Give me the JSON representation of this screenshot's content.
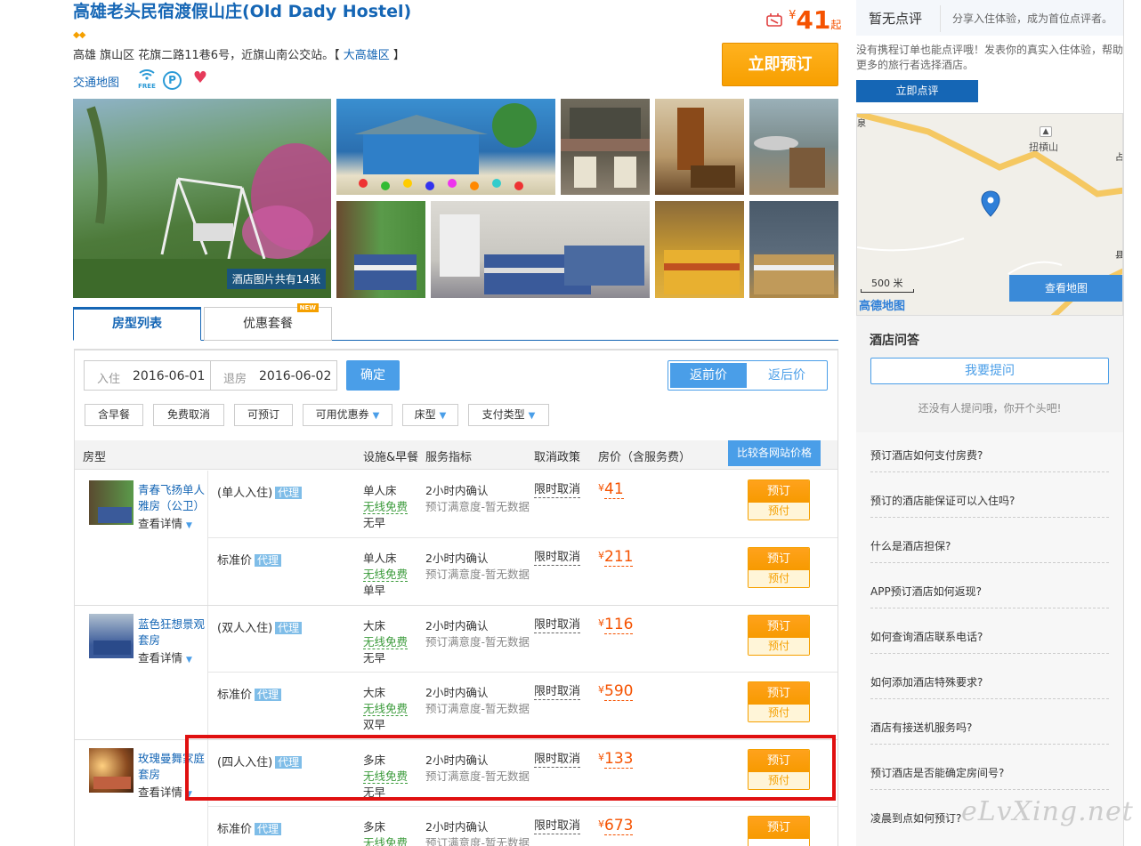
{
  "hotel": {
    "title": "高雄老头民宿渡假山庄(Old Dady Hostel)",
    "diamonds": "◆◆",
    "address_prefix": "高雄 旗山区 花旗二路11巷6号，近旗山南公交站。【",
    "area_link": "大高雄区",
    "address_suffix": "】",
    "map_link": "交通地图",
    "amenities": {
      "wifi_icon": "wifi-icon",
      "wifi_label": "FREE",
      "parking_label": "P",
      "heart": "♥"
    },
    "price_currency": "¥",
    "price_value": "41",
    "price_suffix": "起",
    "book_now": "立即预订",
    "photo_count_label": "酒店图片共有14张"
  },
  "tabs": [
    {
      "label": "房型列表",
      "active": true
    },
    {
      "label": "优惠套餐",
      "badge": "NEW"
    }
  ],
  "search": {
    "checkin_label": "入住",
    "checkin_value": "2016-06-01",
    "checkout_label": "退房",
    "checkout_value": "2016-06-02",
    "confirm": "确定",
    "toggle_before": "返前价",
    "toggle_after": "返后价"
  },
  "filters": [
    "含早餐",
    "免费取消",
    "可预订",
    "可用优惠券",
    "床型",
    "支付类型"
  ],
  "table_headers": {
    "room_type": "房型",
    "facilities": "设施&早餐",
    "service": "服务指标",
    "cancel": "取消政策",
    "price": "房价（含服务费）",
    "compare": "比较各网站价格"
  },
  "rooms": [
    {
      "name": "青春飞扬单人雅房（公卫）",
      "detail": "查看详情",
      "rates": [
        {
          "label": "(单人入住)",
          "agent": "代理",
          "bed": "单人床",
          "wifi": "无线免费",
          "breakfast": "无早",
          "svc1": "2小时内确认",
          "svc2": "预订满意度-暂无数据",
          "cancel": "限时取消",
          "price": "41",
          "book": "预订",
          "pay": "预付"
        },
        {
          "label": "标准价",
          "agent": "代理",
          "bed": "单人床",
          "wifi": "无线免费",
          "breakfast": "单早",
          "svc1": "2小时内确认",
          "svc2": "预订满意度-暂无数据",
          "cancel": "限时取消",
          "price": "211",
          "book": "预订",
          "pay": "预付"
        }
      ]
    },
    {
      "name": "蓝色狂想景观套房",
      "detail": "查看详情",
      "rates": [
        {
          "label": "(双人入住)",
          "agent": "代理",
          "bed": "大床",
          "wifi": "无线免费",
          "breakfast": "无早",
          "svc1": "2小时内确认",
          "svc2": "预订满意度-暂无数据",
          "cancel": "限时取消",
          "price": "116",
          "book": "预订",
          "pay": "预付"
        },
        {
          "label": "标准价",
          "agent": "代理",
          "bed": "大床",
          "wifi": "无线免费",
          "breakfast": "双早",
          "svc1": "2小时内确认",
          "svc2": "预订满意度-暂无数据",
          "cancel": "限时取消",
          "price": "590",
          "book": "预订",
          "pay": "预付"
        }
      ]
    },
    {
      "name": "玫瑰曼舞家庭套房",
      "detail": "查看详情",
      "rates": [
        {
          "label": "(四人入住)",
          "agent": "代理",
          "bed": "多床",
          "wifi": "无线免费",
          "breakfast": "无早",
          "svc1": "2小时内确认",
          "svc2": "预订满意度-暂无数据",
          "cancel": "限时取消",
          "price": "133",
          "book": "预订",
          "pay": "预付"
        },
        {
          "label": "标准价",
          "agent": "代理",
          "bed": "多床",
          "wifi": "无线免费",
          "breakfast": "",
          "svc1": "2小时内确认",
          "svc2": "预订满意度-暂无数据",
          "cancel": "限时取消",
          "price": "673",
          "book": "预订",
          "pay": ""
        }
      ]
    }
  ],
  "currency": "¥",
  "sidebar": {
    "review_title": "暂无点评",
    "review_sub": "分享入住体验，成为首位点评者。",
    "review_text": "没有携程订单也能点评哦！发表你的真实入住体验，帮助更多的旅行者选择酒店。",
    "review_button": "立即点评",
    "map": {
      "place": "扭槓山",
      "scale": "500 米",
      "brand": "高德地图",
      "view_map": "查看地图",
      "edge_labels": [
        "泉",
        "占",
        "县"
      ]
    },
    "qa_title": "酒店问答",
    "ask_button": "我要提问",
    "qa_none": "还没有人提问哦，你开个头吧!",
    "faqs": [
      "预订酒店如何支付房费?",
      "预订的酒店能保证可以入住吗?",
      "什么是酒店担保?",
      "APP预订酒店如何返现?",
      "如何查询酒店联系电话?",
      "如何添加酒店特殊要求?",
      "酒店有接送机服务吗?",
      "预订酒店是否能确定房间号?",
      "凌晨到点如何预订?"
    ]
  },
  "watermark": "eLvXing.net",
  "colors": {
    "brand_blue": "#1566b5",
    "accent_orange": "#f79f00",
    "price_orange": "#f55200",
    "highlight_red": "#e01010"
  }
}
